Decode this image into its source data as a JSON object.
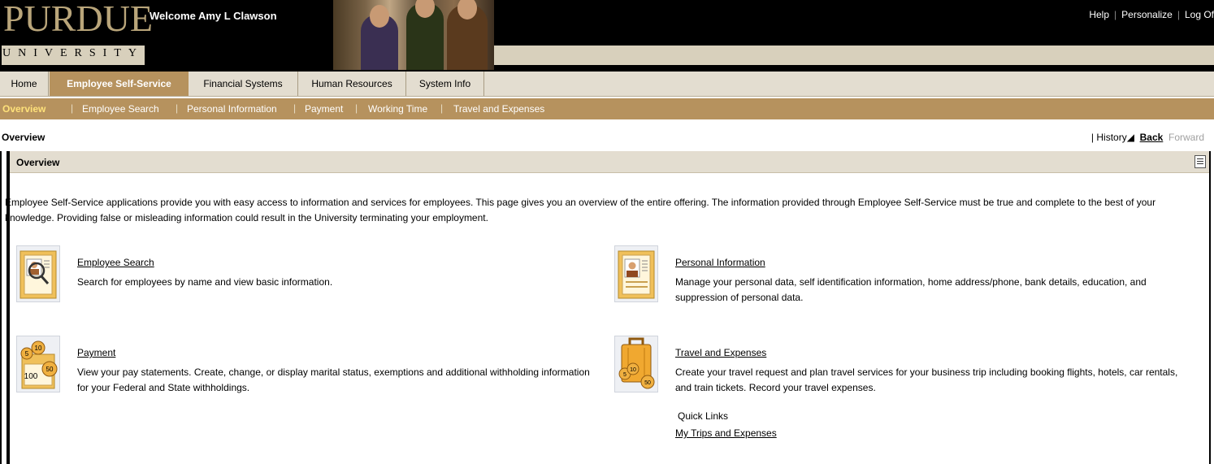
{
  "header": {
    "logo_word": "PURDUE",
    "logo_sub": "UNIVERSITY",
    "welcome": "Welcome Amy L Clawson",
    "links": [
      "Help",
      "Personalize",
      "Log Of"
    ]
  },
  "nav": {
    "tabs": [
      "Home",
      "Employee Self-Service",
      "Financial Systems",
      "Human Resources",
      "System Info"
    ],
    "active_tab": "Employee Self-Service",
    "subtabs": [
      "Overview",
      "Employee Search",
      "Personal Information",
      "Payment",
      "Working Time",
      "Travel and Expenses"
    ],
    "active_subtab": "Overview"
  },
  "page": {
    "title": "Overview",
    "history": "History",
    "back": "Back",
    "forward": "Forward"
  },
  "panel": {
    "title": "Overview",
    "intro": "Employee Self-Service applications provide you with easy access to information and services for employees. This page gives you an overview of the entire offering. The information provided through Employee Self-Service must be true and complete to the best of your knowledge. Providing false or misleading information could result in the University terminating your employment."
  },
  "services": {
    "employee_search": {
      "title": "Employee Search",
      "description": "Search for employees by name and view basic information.",
      "icon": "employee-search-icon"
    },
    "personal_information": {
      "title": "Personal Information",
      "description": "Manage your personal data, self identification information, home address/phone, bank details, education, and suppression of personal data.",
      "icon": "personal-info-icon"
    },
    "payment": {
      "title": "Payment",
      "description": "View your pay statements.  Create, change, or display marital status, exemptions and additional withholding information for your Federal and State withholdings.",
      "icon": "payment-coins-icon",
      "coins": [
        "5",
        "10",
        "50",
        "100"
      ]
    },
    "travel": {
      "title": "Travel and Expenses",
      "description": "Create your travel request and plan travel services for your business trip including booking flights, hotels, car rentals, and train tickets. Record your travel expenses.",
      "icon": "suitcase-icon",
      "coins": [
        "5",
        "10",
        "50"
      ]
    }
  },
  "quick_links": {
    "label": "Quick Links",
    "items": [
      "My Trips and Expenses"
    ]
  },
  "colors": {
    "header_bg": "#000000",
    "nav_active": "#b6925e",
    "nav_bg": "#e3ddd0",
    "accent_gold": "#b9a57a"
  }
}
